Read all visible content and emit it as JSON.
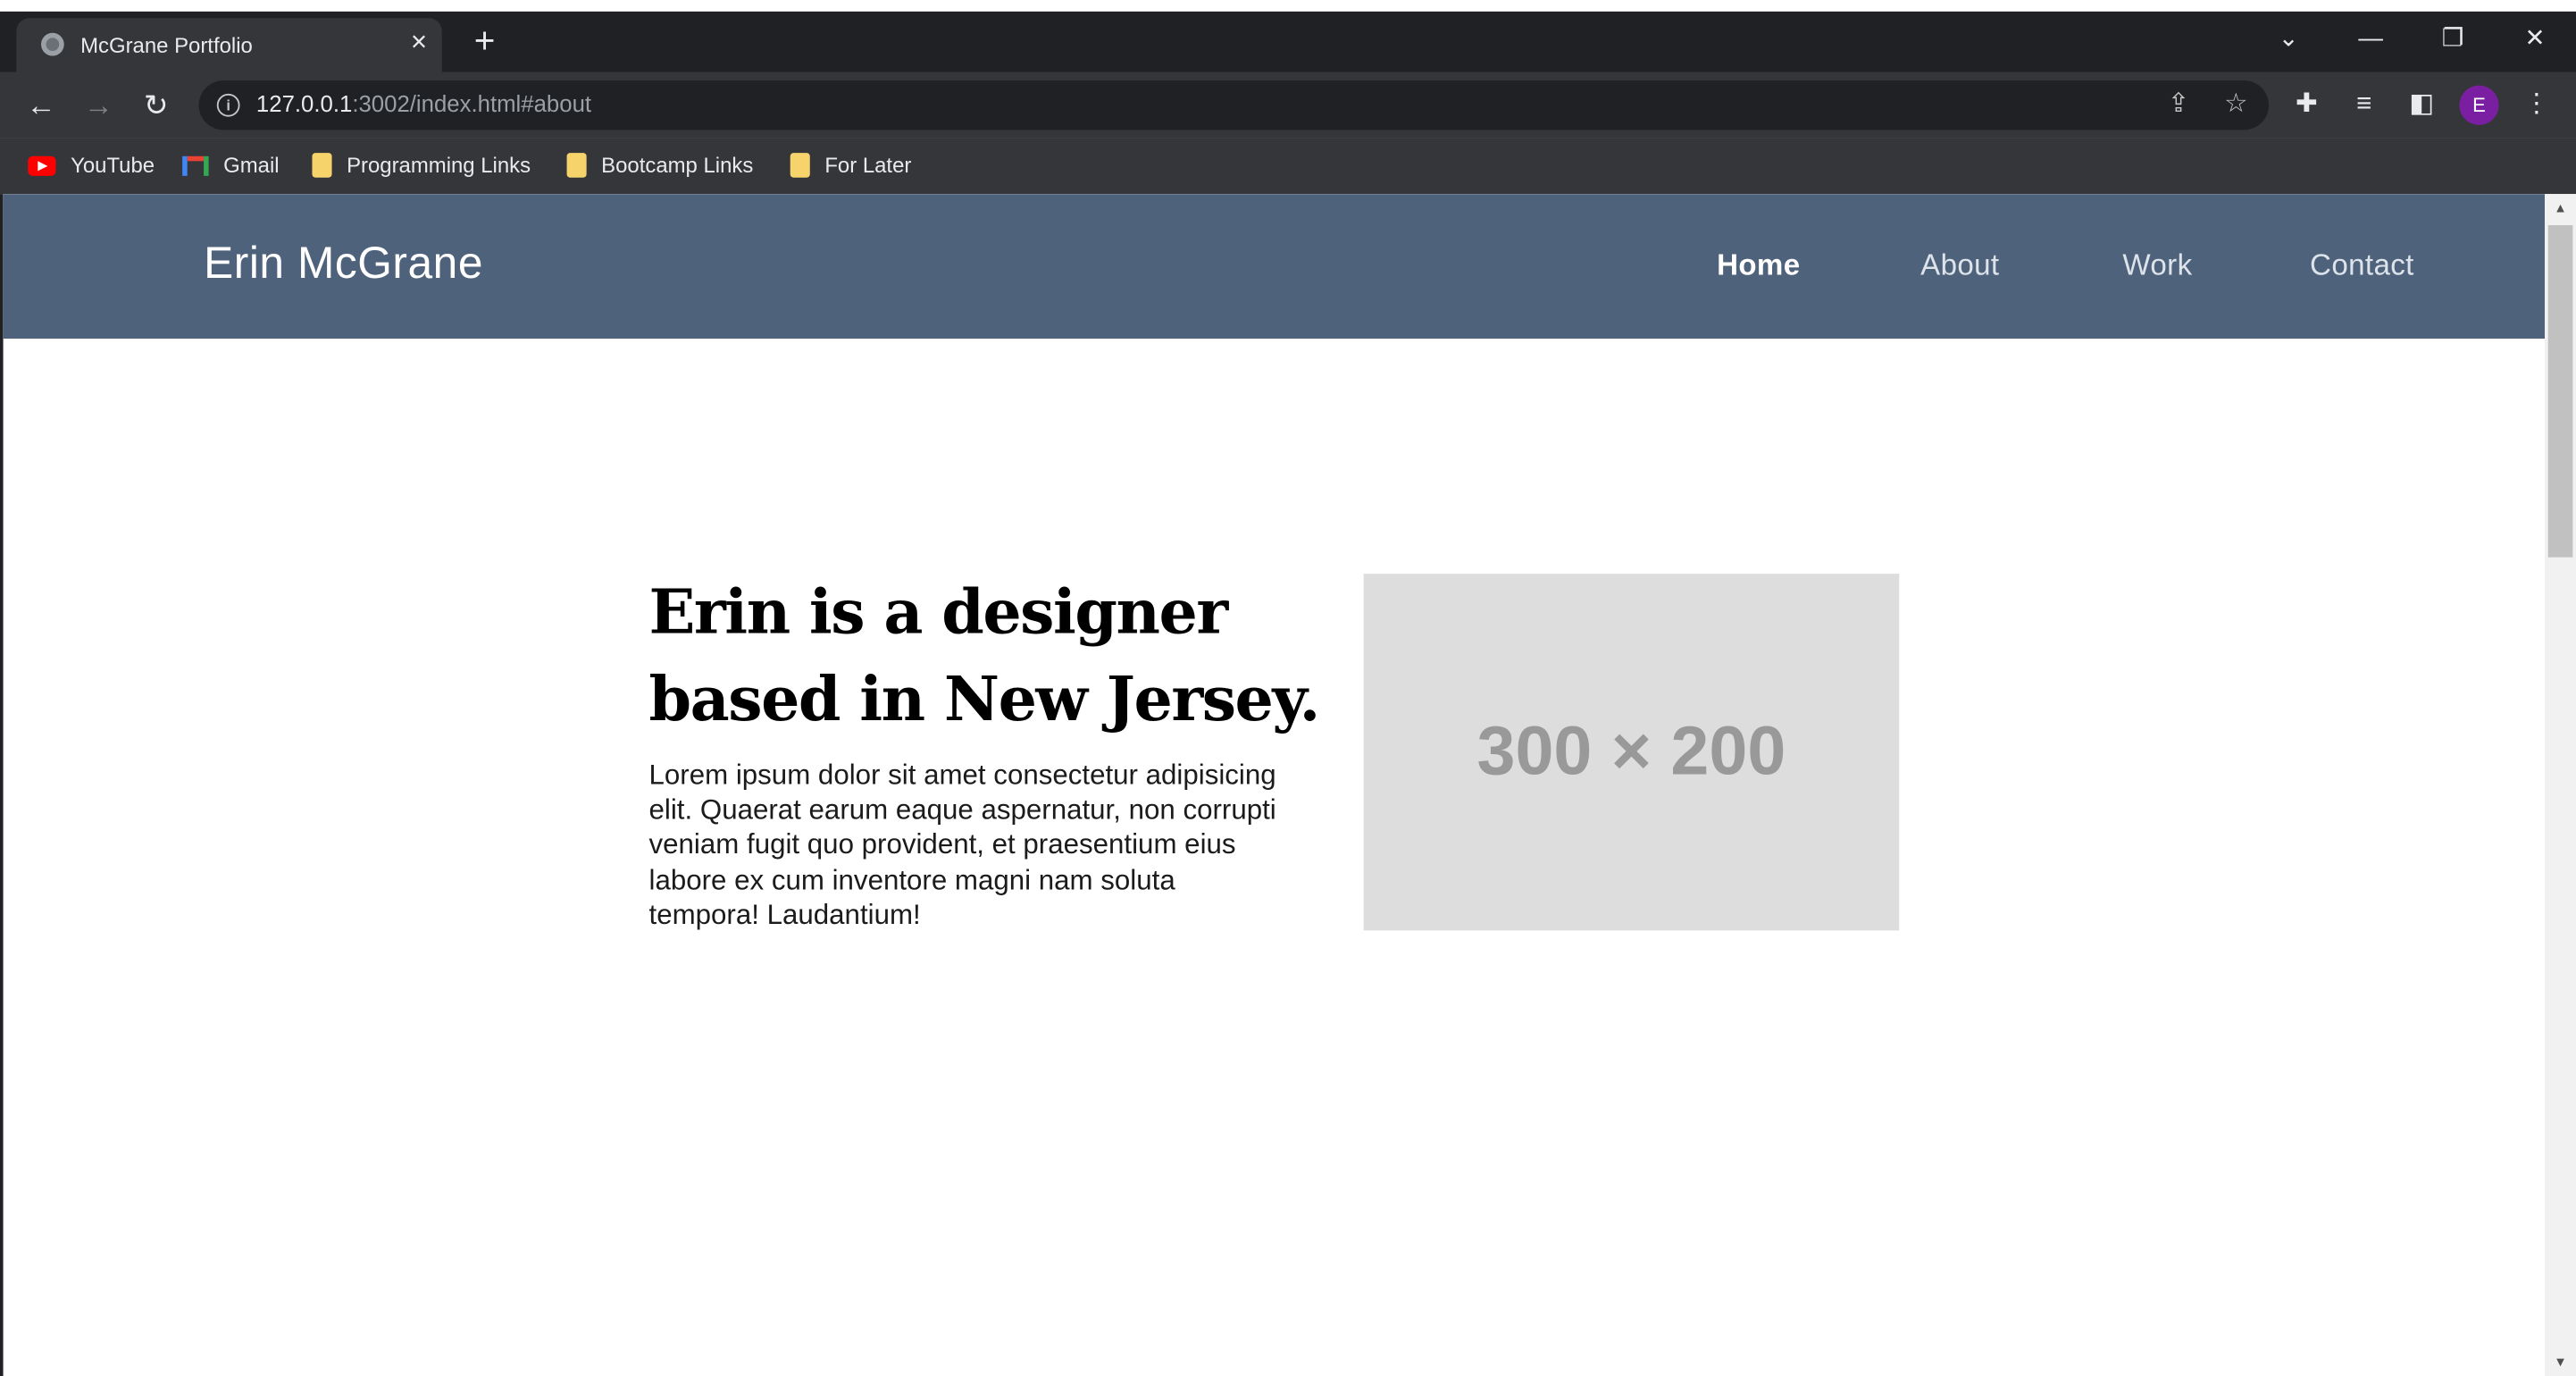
{
  "browser": {
    "tab_title": "McGrane Portfolio",
    "tab_close_glyph": "×",
    "new_tab_glyph": "+",
    "url_host": "127.0.0.1",
    "url_rest": ":3002/index.html#about",
    "icons": {
      "favicon": "globe-icon",
      "back": "back-arrow-icon",
      "forward": "forward-arrow-icon",
      "reload": "reload-icon",
      "info": "info-icon",
      "share": "share-icon",
      "bookmark_star": "star-icon",
      "extensions": "puzzle-icon",
      "media": "media-queue-icon",
      "side_panel": "side-panel-icon",
      "menu": "kebab-menu-icon"
    },
    "profile_initial": "E",
    "bookmarks": [
      {
        "label": "YouTube",
        "icon": "youtube-icon"
      },
      {
        "label": "Gmail",
        "icon": "gmail-icon"
      },
      {
        "label": "Programming Links",
        "icon": "folder-icon"
      },
      {
        "label": "Bootcamp Links",
        "icon": "folder-icon"
      },
      {
        "label": "For Later",
        "icon": "folder-icon"
      }
    ]
  },
  "site": {
    "logo": "Erin McGrane",
    "nav": [
      {
        "label": "Home",
        "active": true
      },
      {
        "label": "About",
        "active": false
      },
      {
        "label": "Work",
        "active": false
      },
      {
        "label": "Contact",
        "active": false
      }
    ],
    "hero": {
      "title": "Erin is a designer based in New Jersey.",
      "body": "Lorem ipsum dolor sit amet consectetur adipisicing elit. Quaerat earum eaque aspernatur, non corrupti veniam fugit quo provident, et praesentium eius labore ex cum inventore magni nam soluta tempora! Laudantium!",
      "image_placeholder": "300 × 200"
    }
  },
  "colors": {
    "header_bg": "#4f627b",
    "placeholder_bg": "#dddddd",
    "placeholder_text": "#999999",
    "profile_avatar": "#7b1fa2"
  }
}
